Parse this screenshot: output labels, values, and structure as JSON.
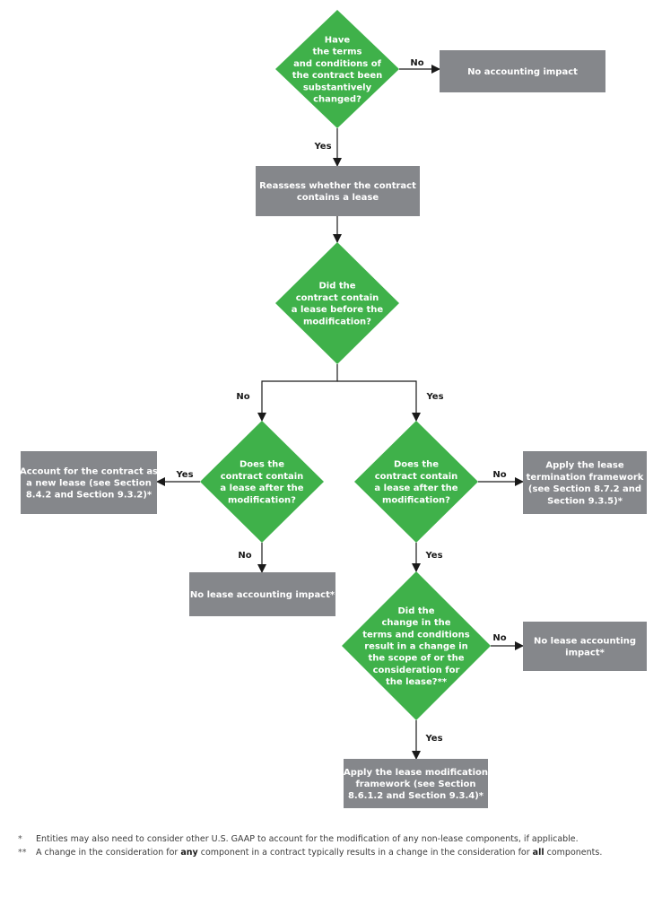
{
  "colors": {
    "decision": "#3fb14a",
    "action": "#85878b",
    "line": "#1a1a1a",
    "text_on_node": "#ffffff"
  },
  "nodes": {
    "d1": {
      "type": "decision",
      "lines": [
        "Have",
        "the terms",
        "and conditions of",
        "the contract been",
        "substantively",
        "changed?"
      ]
    },
    "a_no_impact": {
      "type": "action",
      "lines": [
        "No accounting impact"
      ]
    },
    "a_reassess": {
      "type": "action",
      "lines": [
        "Reassess whether the contract",
        "contains a lease"
      ]
    },
    "d2": {
      "type": "decision",
      "lines": [
        "Did the",
        "contract contain",
        "a lease before the",
        "modification?"
      ]
    },
    "d3": {
      "type": "decision",
      "lines": [
        "Does the",
        "contract contain",
        "a lease after the",
        "modification?"
      ]
    },
    "d4": {
      "type": "decision",
      "lines": [
        "Does the",
        "contract contain",
        "a lease after the",
        "modification?"
      ]
    },
    "a_new_lease": {
      "type": "action",
      "lines": [
        "Account for the contract as",
        "a new lease (see Section",
        "8.4.2 and Section 9.3.2)*"
      ]
    },
    "a_no_lease_left": {
      "type": "action",
      "lines": [
        "No lease accounting impact*"
      ]
    },
    "a_termination": {
      "type": "action",
      "lines": [
        "Apply the lease",
        "termination framework",
        "(see Section 8.7.2 and",
        "Section 9.3.5)*"
      ]
    },
    "d5": {
      "type": "decision",
      "lines": [
        "Did the",
        "change in the",
        "terms and conditions",
        "result in a change in",
        "the scope of or the",
        "consideration for",
        "the lease?**"
      ]
    },
    "a_no_lease_right": {
      "type": "action",
      "lines": [
        "No lease accounting",
        "impact*"
      ]
    },
    "a_modification": {
      "type": "action",
      "lines": [
        "Apply the lease modification",
        "framework (see Section",
        "8.6.1.2 and Section 9.3.4)*"
      ]
    }
  },
  "edges": [
    {
      "from": "d1",
      "to": "a_no_impact",
      "label": "No"
    },
    {
      "from": "d1",
      "to": "a_reassess",
      "label": "Yes"
    },
    {
      "from": "a_reassess",
      "to": "d2",
      "label": ""
    },
    {
      "from": "d2",
      "to": "d3",
      "label": "No"
    },
    {
      "from": "d2",
      "to": "d4",
      "label": "Yes"
    },
    {
      "from": "d3",
      "to": "a_new_lease",
      "label": "Yes"
    },
    {
      "from": "d3",
      "to": "a_no_lease_left",
      "label": "No"
    },
    {
      "from": "d4",
      "to": "a_termination",
      "label": "No"
    },
    {
      "from": "d4",
      "to": "d5",
      "label": "Yes"
    },
    {
      "from": "d5",
      "to": "a_no_lease_right",
      "label": "No"
    },
    {
      "from": "d5",
      "to": "a_modification",
      "label": "Yes"
    }
  ],
  "footnotes": [
    {
      "mark": "*",
      "parts": [
        {
          "text": "Entities may also need to consider other U.S. GAAP to account for the modification of any non-lease components, if applicable.",
          "bold": false
        }
      ]
    },
    {
      "mark": "**",
      "parts": [
        {
          "text": "A change in the consideration for ",
          "bold": false
        },
        {
          "text": "any",
          "bold": true
        },
        {
          "text": " component in a contract typically results in a change in the consideration for ",
          "bold": false
        },
        {
          "text": "all",
          "bold": true
        },
        {
          "text": " components.",
          "bold": false
        }
      ]
    }
  ]
}
